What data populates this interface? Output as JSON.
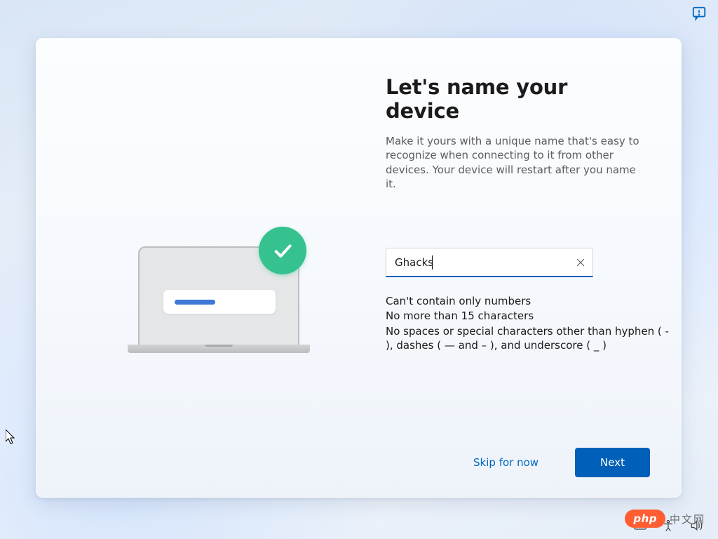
{
  "header": {
    "title": "Let's name your device",
    "subtitle": "Make it yours with a unique name that's easy to recognize when connecting to it from other devices. Your device will restart after you name it."
  },
  "input": {
    "value": "Ghacks",
    "placeholder": ""
  },
  "rules": {
    "line1": "Can't contain only numbers",
    "line2": "No more than 15 characters",
    "line3": "No spaces or special characters other than hyphen ( - ), dashes ( — and – ), and underscore ( _ )"
  },
  "buttons": {
    "skip": "Skip for now",
    "next": "Next"
  },
  "watermark": {
    "badge": "php",
    "text": "中文网"
  }
}
